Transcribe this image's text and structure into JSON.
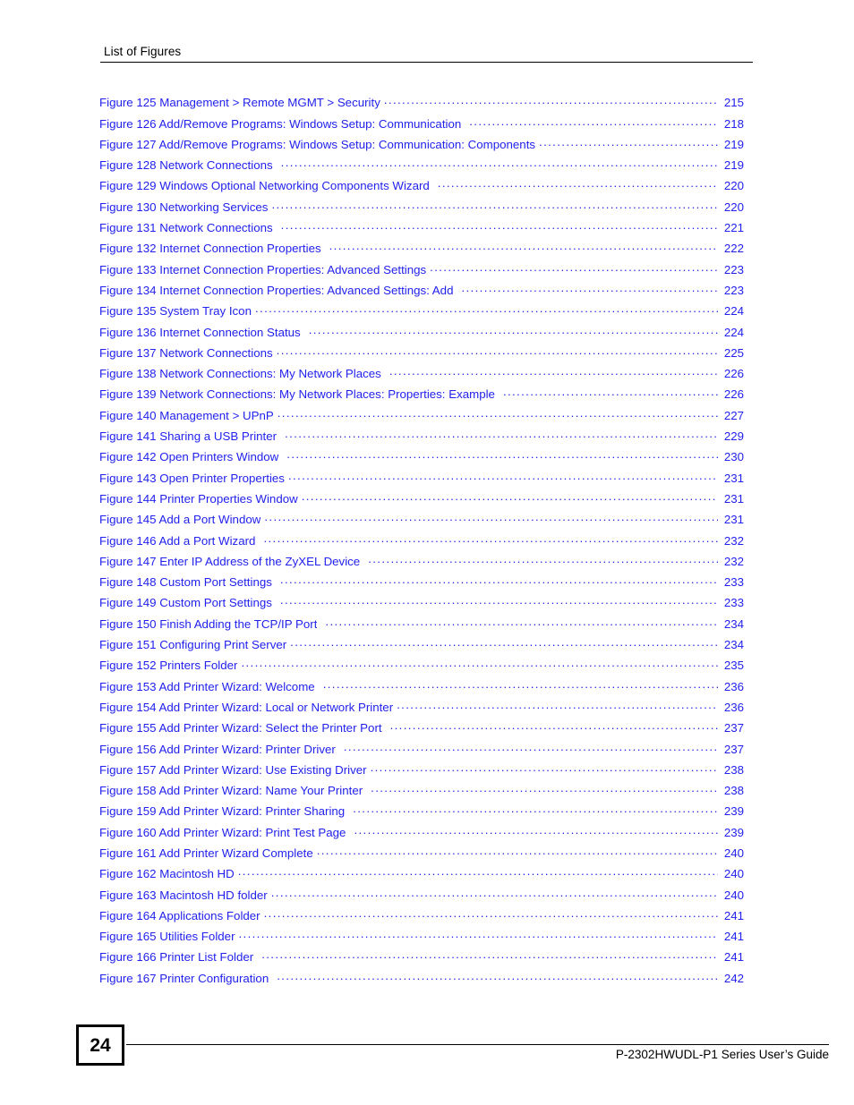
{
  "header": {
    "title": "List of Figures"
  },
  "toc": {
    "entries": [
      {
        "label": "Figure 125 Management > Remote MGMT > Security",
        "page": "215",
        "wide_gap": false
      },
      {
        "label": "Figure 126 Add/Remove Programs: Windows Setup: Communication",
        "page": "218",
        "wide_gap": true
      },
      {
        "label": "Figure 127 Add/Remove Programs: Windows Setup: Communication: Components",
        "page": "219",
        "wide_gap": false
      },
      {
        "label": "Figure 128 Network Connections",
        "page": "219",
        "wide_gap": true
      },
      {
        "label": "Figure 129 Windows Optional Networking Components Wizard",
        "page": "220",
        "wide_gap": true
      },
      {
        "label": "Figure 130 Networking Services",
        "page": "220",
        "wide_gap": false
      },
      {
        "label": "Figure 131 Network Connections",
        "page": "221",
        "wide_gap": true
      },
      {
        "label": "Figure 132 Internet Connection Properties",
        "page": "222",
        "wide_gap": true
      },
      {
        "label": "Figure 133 Internet Connection Properties: Advanced Settings",
        "page": "223",
        "wide_gap": false
      },
      {
        "label": "Figure 134 Internet Connection Properties: Advanced Settings: Add",
        "page": "223",
        "wide_gap": true
      },
      {
        "label": "Figure 135 System Tray Icon",
        "page": "224",
        "wide_gap": false
      },
      {
        "label": "Figure 136 Internet Connection Status",
        "page": "224",
        "wide_gap": true
      },
      {
        "label": "Figure 137 Network Connections",
        "page": "225",
        "wide_gap": false
      },
      {
        "label": "Figure 138 Network Connections: My Network Places",
        "page": "226",
        "wide_gap": true
      },
      {
        "label": "Figure 139 Network Connections: My Network Places: Properties: Example",
        "page": "226",
        "wide_gap": true
      },
      {
        "label": "Figure 140 Management > UPnP",
        "page": "227",
        "wide_gap": false
      },
      {
        "label": "Figure 141 Sharing a USB Printer",
        "page": "229",
        "wide_gap": true
      },
      {
        "label": "Figure 142 Open Printers Window",
        "page": "230",
        "wide_gap": true
      },
      {
        "label": "Figure 143 Open Printer Properties",
        "page": "231",
        "wide_gap": false
      },
      {
        "label": "Figure 144 Printer Properties Window",
        "page": "231",
        "wide_gap": false
      },
      {
        "label": "Figure 145 Add a Port Window",
        "page": "231",
        "wide_gap": false
      },
      {
        "label": "Figure 146 Add a Port Wizard",
        "page": "232",
        "wide_gap": true
      },
      {
        "label": "Figure 147 Enter IP Address of the ZyXEL Device",
        "page": "232",
        "wide_gap": true
      },
      {
        "label": "Figure 148 Custom Port Settings",
        "page": "233",
        "wide_gap": true
      },
      {
        "label": "Figure 149 Custom Port Settings",
        "page": "233",
        "wide_gap": true
      },
      {
        "label": "Figure 150 Finish Adding the TCP/IP Port",
        "page": "234",
        "wide_gap": true
      },
      {
        "label": "Figure 151 Configuring Print Server",
        "page": "234",
        "wide_gap": false
      },
      {
        "label": "Figure 152 Printers Folder",
        "page": "235",
        "wide_gap": false
      },
      {
        "label": "Figure 153 Add Printer Wizard: Welcome",
        "page": "236",
        "wide_gap": true
      },
      {
        "label": "Figure 154 Add Printer Wizard: Local or Network Printer",
        "page": "236",
        "wide_gap": false
      },
      {
        "label": "Figure 155 Add Printer Wizard: Select the Printer Port",
        "page": "237",
        "wide_gap": true
      },
      {
        "label": "Figure 156 Add Printer Wizard: Printer Driver",
        "page": "237",
        "wide_gap": true
      },
      {
        "label": "Figure 157 Add Printer Wizard: Use Existing Driver",
        "page": "238",
        "wide_gap": false
      },
      {
        "label": "Figure 158 Add Printer Wizard: Name Your Printer",
        "page": "238",
        "wide_gap": true
      },
      {
        "label": "Figure 159 Add Printer Wizard: Printer Sharing",
        "page": "239",
        "wide_gap": true
      },
      {
        "label": "Figure 160 Add Printer Wizard: Print Test Page",
        "page": "239",
        "wide_gap": true
      },
      {
        "label": "Figure 161 Add Printer Wizard Complete",
        "page": "240",
        "wide_gap": false
      },
      {
        "label": "Figure 162 Macintosh HD",
        "page": "240",
        "wide_gap": false
      },
      {
        "label": "Figure 163 Macintosh HD folder",
        "page": "240",
        "wide_gap": false
      },
      {
        "label": "Figure 164 Applications Folder",
        "page": "241",
        "wide_gap": false
      },
      {
        "label": "Figure 165 Utilities Folder",
        "page": "241",
        "wide_gap": false
      },
      {
        "label": "Figure 166 Printer List Folder",
        "page": "241",
        "wide_gap": true
      },
      {
        "label": "Figure 167 Printer Configuration",
        "page": "242",
        "wide_gap": true
      }
    ]
  },
  "footer": {
    "page_number": "24",
    "guide_title": "P-2302HWUDL-P1 Series User’s Guide"
  },
  "colors": {
    "entry_text": "#2222ee",
    "body_text": "#000000",
    "background": "#ffffff"
  }
}
